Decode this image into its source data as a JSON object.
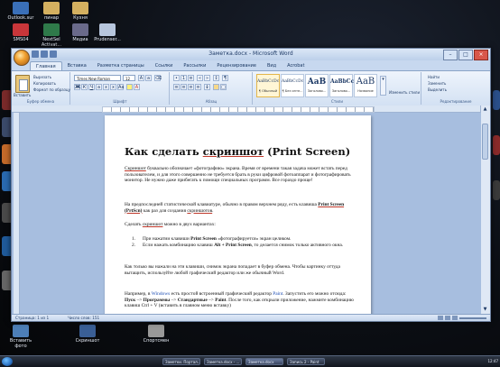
{
  "desktop": {
    "top_icons": [
      {
        "label": "Outlook.sur"
      },
      {
        "label": "пинар"
      },
      {
        "label": "Кухня"
      }
    ],
    "row2_icons": [
      {
        "label": "SMS04"
      },
      {
        "label": "NextSel Activat..."
      },
      {
        "label": "Медиа"
      },
      {
        "label": "Prudenser..."
      }
    ],
    "bottom_icons": [
      {
        "label": "Вставить фото"
      },
      {
        "label": "Скриншот"
      },
      {
        "label": "Спортсмен"
      }
    ]
  },
  "window": {
    "title": "Заметка.docx - Microsoft Word",
    "tabs": [
      "Главная",
      "Вставка",
      "Разметка страницы",
      "Ссылки",
      "Рассылки",
      "Рецензирование",
      "Вид",
      "Acrobat"
    ],
    "clipboard": {
      "paste_label": "Вставить",
      "cut_label": "Вырезать",
      "copy_label": "Копировать",
      "format_painter_label": "Формат по образцу",
      "group_label": "Буфер обмена"
    },
    "font": {
      "name": "Times New Roman",
      "size": "12",
      "group_label": "Шрифт"
    },
    "paragraph_group_label": "Абзац",
    "styles": [
      {
        "sample": "AaBbCcDc",
        "name": "¶ Обычный"
      },
      {
        "sample": "AaBbCcDc",
        "name": "¶ Без инте..."
      },
      {
        "sample": "AaB",
        "name": "Заголово..."
      },
      {
        "sample": "AaBbCc",
        "name": "Заголово..."
      },
      {
        "sample": "AaB",
        "name": "Название"
      }
    ],
    "styles_group_label": "Стили",
    "change_styles_label": "Изменить стили",
    "editing": {
      "find_label": "Найти",
      "replace_label": "Заменить",
      "select_label": "Выделить",
      "group_label": "Редактирование"
    },
    "status": {
      "page": "Страница: 1 из 1",
      "words": "Число слов: 151"
    }
  },
  "document": {
    "heading_pre": "Как сделать ",
    "heading_word": "скриншот",
    "heading_post": " (Print Screen)",
    "p1_pre": "",
    "p1_word": "Скриншот",
    "p1_post": " буквально обозначает «фотографию» экрана. Время от времени такая задача может встать перед пользователем, и для этого совершенно не требуется брать в руки цифровой фотоаппарат и фотографировать монитор. Не нужно даже прибегать к помощи специальных программ. Все гораздо проще!",
    "p2_pre": "На предпоследней статистической клавиатуре, обычно в правом верхнем ряду, есть клавиша ",
    "p2_bold": "Print Screen (PrtScn)",
    "p2_mid": " как раз для создания ",
    "p2_word": "скриншотов",
    "p2_post": ".",
    "p3_pre": "Сделать ",
    "p3_word": "скриншот",
    "p3_post": " можно в двух вариантах:",
    "list": [
      {
        "n": "1.",
        "pre": "При нажатии клавиши ",
        "bold": "Print Screen",
        "post": " «фотографируется» экран целиком."
      },
      {
        "n": "2.",
        "pre": "Если нажать комбинацию клавиш ",
        "bold": "Alt + Print Screen",
        "post": ", то делается снимок только активного окна."
      }
    ],
    "p4": "Как только вы нажали на эти клавиши, снимок экрана попадает в буфер обмена. Чтобы картинку оттуда вытащить, используйте любой графический редактор или же обычный Word.",
    "p5_pre": "Например, в ",
    "p5_link": "Windows",
    "p5_mid": " есть простой встроенный графический редактор ",
    "p5_link2": "Paint",
    "p5_mid2": ". Запустить его можно отсюда: ",
    "p5_b1": "Пуск",
    "p5_a1": " –> ",
    "p5_b2": "Программы",
    "p5_a2": " –> ",
    "p5_b3": "Стандартные",
    "p5_a3": " –> ",
    "p5_b4": "Paint",
    "p5_post": ". После того, как открыли приложение, нажмите комбинацию клавиш Ctrl + V (вставить в главном меню вставку)"
  },
  "taskbar": {
    "items": [
      "Заметки. Портал...",
      "Заметка.docx - ...",
      "Заметка.docx",
      "Запись 2 - Paint"
    ],
    "clock": "12:47"
  }
}
